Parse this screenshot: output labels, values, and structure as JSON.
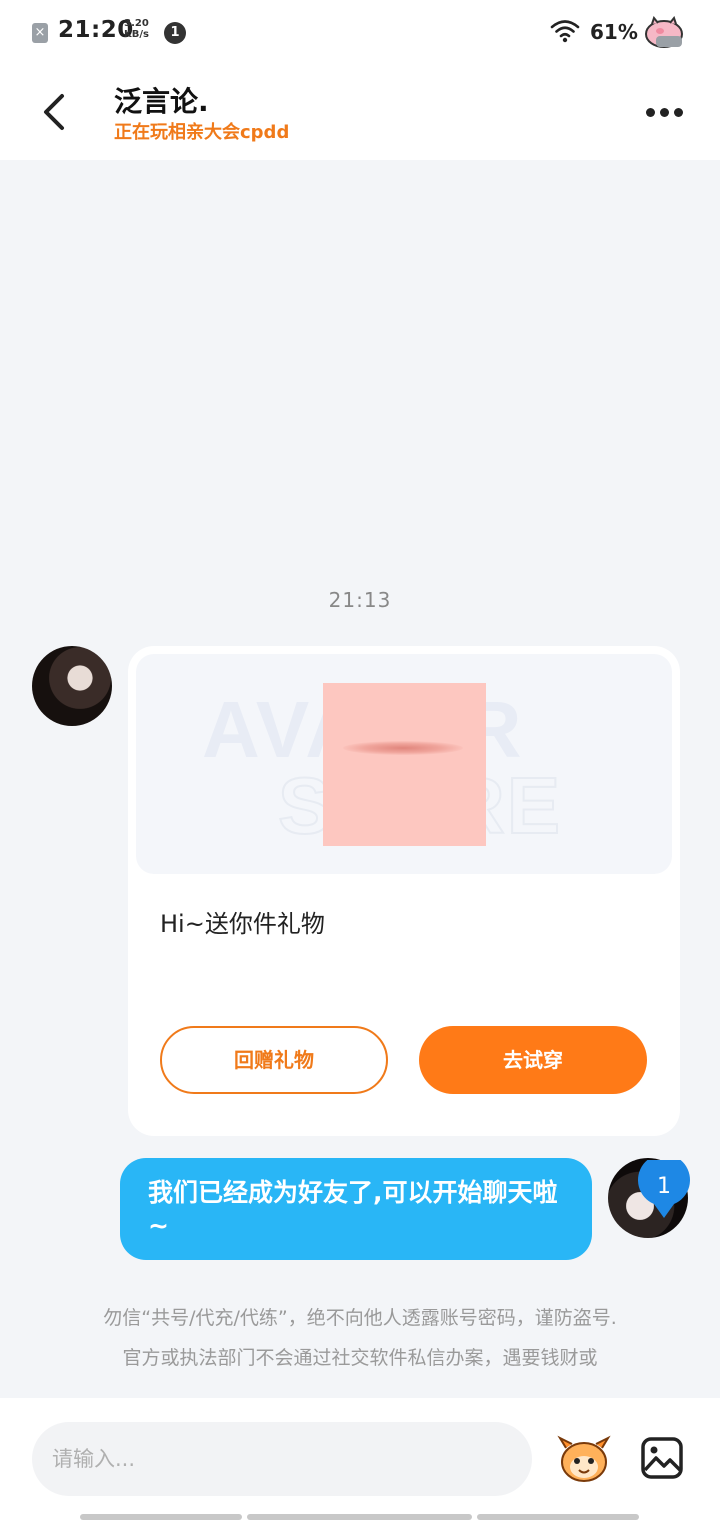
{
  "status_bar": {
    "time": "21:20",
    "speed_value": "3.20",
    "speed_unit": "KB/s",
    "notification_count": "1",
    "battery": "61%"
  },
  "header": {
    "name": "泛言论.",
    "subtitle": "正在玩相亲大会cpdd"
  },
  "chat": {
    "timestamp": "21:13",
    "gift_card": {
      "message": "Hi~送你件礼物",
      "return_gift_label": "回赠礼物",
      "try_on_label": "去试穿"
    },
    "my_message": "我们已经成为好友了,可以开始聊天啦~",
    "notice_line1": "勿信“共号/代充/代练”，绝不向他人透露账号密码，谨防盗号.",
    "notice_line2": "官方或执法部门不会通过社交软件私信办案，遇要钱财或"
  },
  "floating_badge": "1",
  "input": {
    "placeholder": "请输入..."
  },
  "colors": {
    "accent_orange": "#ff7a17",
    "bubble_blue": "#29b6f6",
    "background": "#f3f5f8"
  }
}
